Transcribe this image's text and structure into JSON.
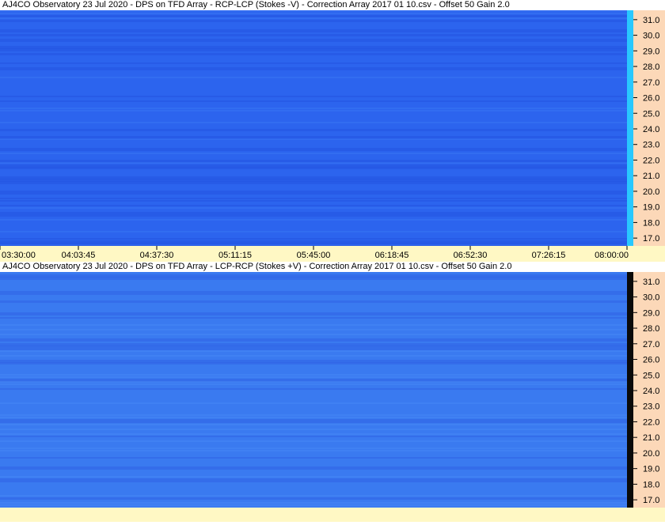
{
  "charts_meta": {
    "time_ticks": [
      "03:30:00",
      "04:03:45",
      "04:37:30",
      "05:11:15",
      "05:45:00",
      "06:18:45",
      "06:52:30",
      "07:26:15",
      "08:00:00"
    ]
  },
  "chart_data": [
    {
      "type": "heatmap",
      "title": "AJ4CO Observatory 23 Jul 2020  -  DPS on TFD Array  -  RCP-LCP (Stokes -V)  -  Correction Array 2017 01 10.csv  -  Offset 50  Gain 2.0",
      "x_tick_labels": [
        "03:30:00",
        "04:03:45",
        "04:37:30",
        "05:11:15",
        "05:45:00",
        "06:18:45",
        "06:52:30",
        "07:26:15",
        "08:00:00"
      ],
      "y_tick_labels": [
        "31.0",
        "30.0",
        "29.0",
        "28.0",
        "27.0",
        "26.0",
        "25.0",
        "24.0",
        "23.0",
        "22.0",
        "21.0",
        "20.0",
        "19.0",
        "18.0",
        "17.0"
      ],
      "xlim": [
        "03:30:00",
        "08:00:00"
      ],
      "ylim": [
        16.5,
        31.6
      ],
      "colors": {
        "base": "#2c64ee",
        "dark_band": "#2454e2",
        "light_band": "#3a78f4",
        "colorbar": "#28c8ff",
        "axis_bg": "#fcd8b8"
      }
    },
    {
      "type": "heatmap",
      "title": "AJ4CO Observatory 23 Jul 2020  -  DPS on TFD Array  -  LCP-RCP (Stokes +V)  -  Correction Array 2017 01 10.csv  -  Offset 50  Gain 2.0",
      "x_tick_labels": [],
      "y_tick_labels": [
        "31.0",
        "30.0",
        "29.0",
        "28.0",
        "27.0",
        "26.0",
        "25.0",
        "24.0",
        "23.0",
        "22.0",
        "21.0",
        "20.0",
        "19.0",
        "18.0",
        "17.0"
      ],
      "xlim": [
        "03:30:00",
        "08:00:00"
      ],
      "ylim": [
        16.5,
        31.6
      ],
      "colors": {
        "base": "#3a7af0",
        "dark_band": "#2f62e6",
        "light_band": "#4a8af6",
        "colorbar": "#0a0a0a",
        "axis_bg": "#fcd8b8"
      }
    }
  ]
}
